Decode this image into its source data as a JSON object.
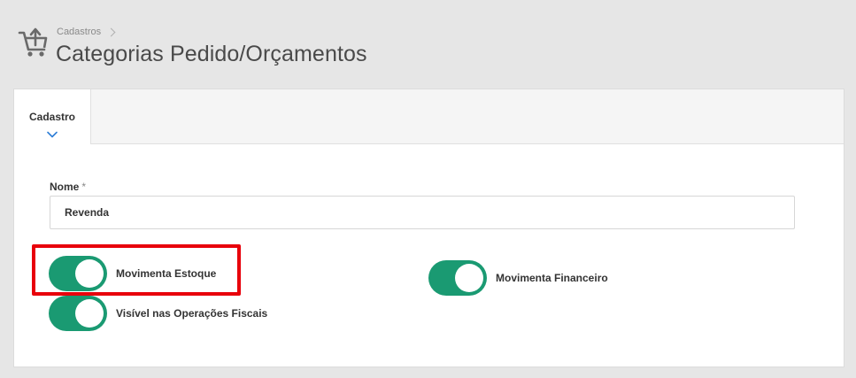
{
  "header": {
    "breadcrumb": "Cadastros",
    "title": "Categorias Pedido/Orçamentos",
    "icon": "cart-upload-icon"
  },
  "tabs": [
    {
      "label": "Cadastro",
      "active": true,
      "icon": "chevron-down-icon"
    }
  ],
  "form": {
    "nome_label": "Nome",
    "nome_required_mark": "*",
    "nome_value": "Revenda",
    "toggles": {
      "movimenta_estoque": {
        "label": "Movimenta Estoque",
        "on": true
      },
      "movimenta_financeiro": {
        "label": "Movimenta Financeiro",
        "on": true
      },
      "visivel_operacoes_fiscais": {
        "label": "Visível nas Operações Fiscais",
        "on": true
      }
    }
  },
  "colors": {
    "toggle_on": "#1a9a72",
    "highlight": "#e8000b",
    "tab_chevron": "#2f7fd6"
  }
}
